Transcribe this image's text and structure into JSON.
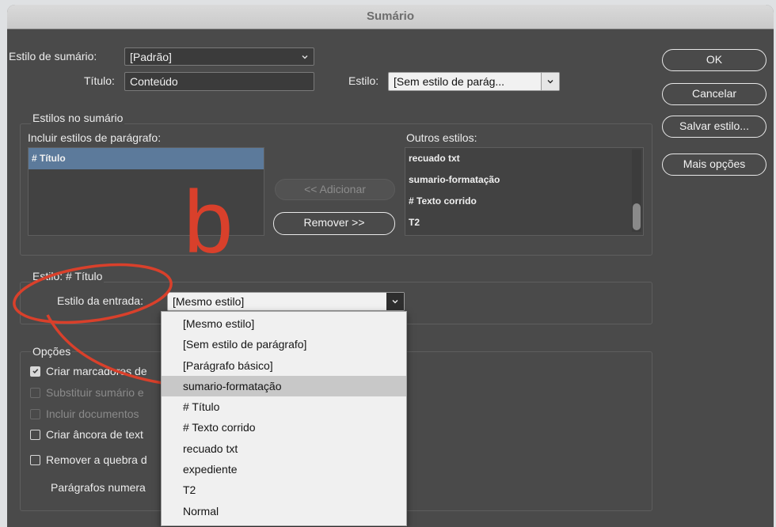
{
  "window": {
    "title": "Sumário"
  },
  "top": {
    "estilo_sumario_label": "Estilo de sumário:",
    "estilo_sumario_value": "[Padrão]",
    "titulo_label": "Título:",
    "titulo_value": "Conteúdo",
    "estilo_label": "Estilo:",
    "estilo_value": "[Sem estilo de parág..."
  },
  "buttons": {
    "ok": "OK",
    "cancelar": "Cancelar",
    "salvar": "Salvar estilo...",
    "mais": "Mais opções"
  },
  "estilos_group": {
    "title": "Estilos no sumário",
    "incluir_label": "Incluir estilos de parágrafo:",
    "incluir_items": [
      "# Título"
    ],
    "adicionar_label": "<< Adicionar",
    "remover_label": "Remover >>",
    "outros_label": "Outros estilos:",
    "outros_items": [
      "recuado txt",
      "sumario-formatação",
      "# Texto corrido",
      "T2"
    ]
  },
  "annotation": {
    "letter": "b",
    "color": "#d9402b"
  },
  "estilo_group": {
    "title": "Estilo: # Título",
    "entrada_label": "Estilo da entrada:",
    "entrada_value": "[Mesmo estilo]"
  },
  "opcoes_group": {
    "title": "Opções",
    "items": [
      {
        "label": "Criar marcadores de",
        "checked": true,
        "enabled": true
      },
      {
        "label": "Substituir sumário e",
        "checked": false,
        "enabled": false
      },
      {
        "label": "Incluir documentos",
        "checked": false,
        "enabled": false
      },
      {
        "label": "Criar âncora de text",
        "checked": false,
        "enabled": true
      },
      {
        "label": "Remover a quebra d",
        "checked": false,
        "enabled": true
      }
    ],
    "paragrafos_label": "Parágrafos numera"
  },
  "dropdown": {
    "items": [
      "[Mesmo estilo]",
      "[Sem estilo de parágrafo]",
      "[Parágrafo básico]",
      "sumario-formatação",
      "# Título",
      "# Texto corrido",
      "recuado txt",
      "expediente",
      "T2",
      "Normal"
    ],
    "highlighted_index": 3
  }
}
